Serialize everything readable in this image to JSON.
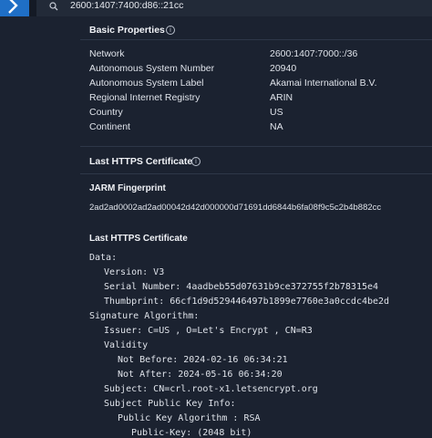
{
  "topbar": {
    "search_value": "2600:1407:7400:d86::21cc"
  },
  "basic_properties": {
    "title": "Basic Properties",
    "rows": [
      {
        "label": "Network",
        "value": "2600:1407:7000::/36"
      },
      {
        "label": "Autonomous System Number",
        "value": "20940"
      },
      {
        "label": "Autonomous System Label",
        "value": "Akamai International B.V."
      },
      {
        "label": "Regional Internet Registry",
        "value": "ARIN"
      },
      {
        "label": "Country",
        "value": "US"
      },
      {
        "label": "Continent",
        "value": "NA"
      }
    ]
  },
  "last_https": {
    "title": "Last HTTPS Certificate",
    "jarm_title": "JARM Fingerprint",
    "jarm_value": "2ad2ad0002ad2ad00042d42d000000d71691dd6844b6fa08f9c5c2b4b882cc",
    "cert_title": "Last HTTPS Certificate",
    "cert_lines": [
      "Data:",
      "Version: V3",
      "Serial Number: 4aadbeb55d07631b9ce372755f2b78315e4",
      "Thumbprint: 66cf1d9d529446497b1899e7760e3a0ccdc4be2d",
      "Signature Algorithm:",
      "Issuer: C=US , O=Let's Encrypt , CN=R3",
      "Validity",
      "Not Before: 2024-02-16 06:34:21",
      "Not After: 2024-05-16 06:34:20",
      "Subject: CN=crl.root-x1.letsencrypt.org",
      "Subject Public Key Info:",
      "Public Key Algorithm : RSA",
      "Public-Key: (2048 bit)"
    ]
  }
}
